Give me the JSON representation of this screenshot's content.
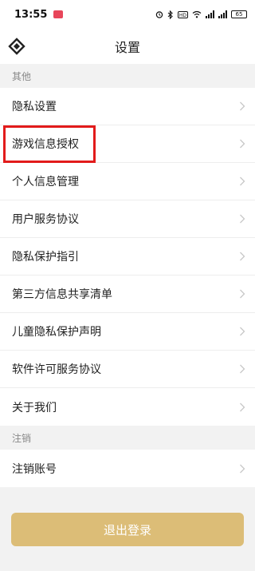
{
  "status_bar": {
    "time": "13:55",
    "battery": "65",
    "icons": [
      "app-notification-icon",
      "alarm-icon",
      "bluetooth-icon",
      "hd-icon",
      "wifi-icon",
      "signal-icon",
      "battery-icon"
    ]
  },
  "header": {
    "title": "设置",
    "back_icon": "back-logo-icon"
  },
  "sections": [
    {
      "label": "其他",
      "items": [
        {
          "label": "隐私设置"
        },
        {
          "label": "游戏信息授权"
        },
        {
          "label": "个人信息管理"
        },
        {
          "label": "用户服务协议"
        },
        {
          "label": "隐私保护指引"
        },
        {
          "label": "第三方信息共享清单"
        },
        {
          "label": "儿童隐私保护声明"
        },
        {
          "label": "软件许可服务协议"
        },
        {
          "label": "关于我们"
        }
      ]
    },
    {
      "label": "注销",
      "items": [
        {
          "label": "注销账号"
        }
      ]
    }
  ],
  "highlight": {
    "color": "#e21b1b",
    "target": "游戏信息授权"
  },
  "logout_button": {
    "label": "退出登录",
    "color": "#dcbd77"
  }
}
